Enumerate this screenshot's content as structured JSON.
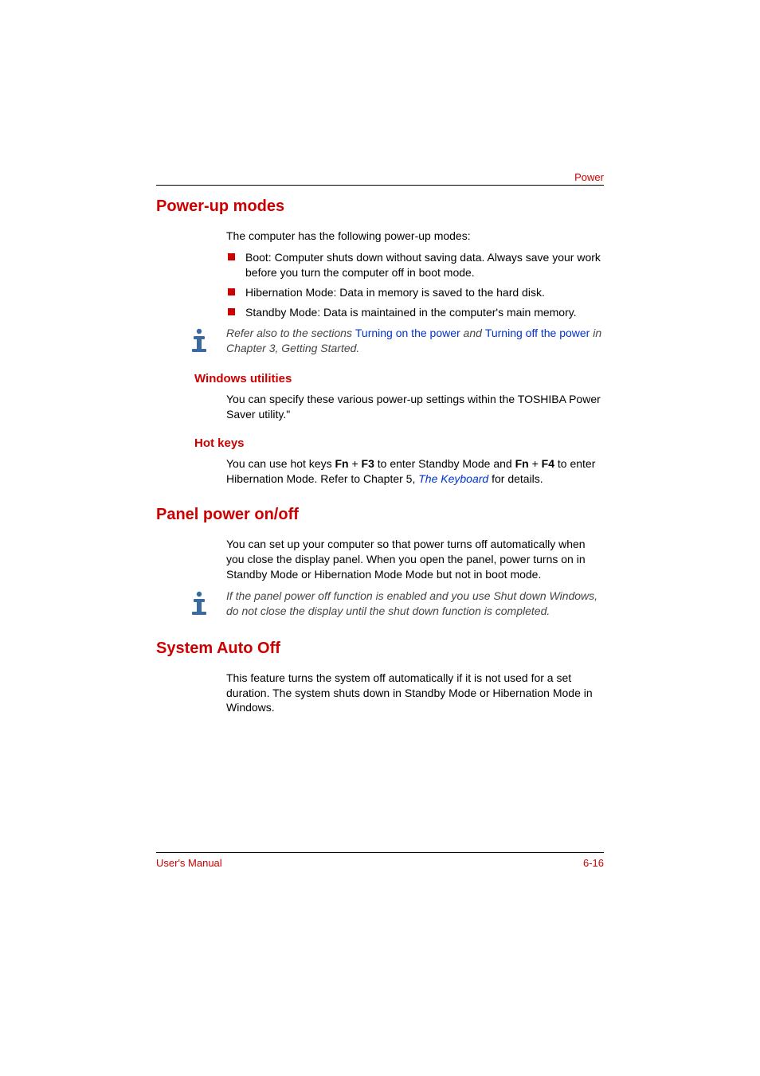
{
  "header": {
    "label": "Power"
  },
  "sections": {
    "powerup": {
      "title": "Power-up modes",
      "intro": "The computer has the following power-up modes:",
      "bullets": [
        "Boot: Computer shuts down without saving data. Always save your work before you turn the computer off in boot mode.",
        "Hibernation Mode: Data in memory is saved to the hard disk.",
        "Standby Mode: Data is maintained in the computer's main memory."
      ],
      "note": {
        "pre": "Refer also to the sections ",
        "link1": "Turning on the power",
        "mid": " and ",
        "link2": "Turning off the power",
        "post": " in Chapter 3, Getting Started."
      },
      "windows": {
        "title": "Windows utilities",
        "text": "You can specify these various power-up settings within the TOSHIBA Power Saver utility.\""
      },
      "hotkeys": {
        "title": "Hot keys",
        "pre": "You can use hot keys ",
        "k1a": "Fn",
        "plus1": " + ",
        "k1b": "F3",
        "mid1": " to enter Standby Mode and ",
        "k2a": "Fn",
        "plus2": " + ",
        "k2b": "F4",
        "mid2": " to enter Hibernation Mode. Refer to Chapter 5, ",
        "link": "The Keyboard",
        "post": " for details."
      }
    },
    "panel": {
      "title": "Panel power on/off",
      "text": "You can set up your computer so that power turns off automatically when you close the display panel. When you open the panel, power turns on in Standby Mode or Hibernation Mode Mode but not in boot mode.",
      "note": "If the panel power off function is enabled and you use Shut down Windows, do not close the display until the shut down function is completed."
    },
    "autooff": {
      "title": "System Auto Off",
      "text": "This feature turns the system off automatically if it is not used for a set duration. The system shuts down in Standby Mode or Hibernation Mode in Windows."
    }
  },
  "footer": {
    "left": "User's Manual",
    "right": "6-16"
  }
}
